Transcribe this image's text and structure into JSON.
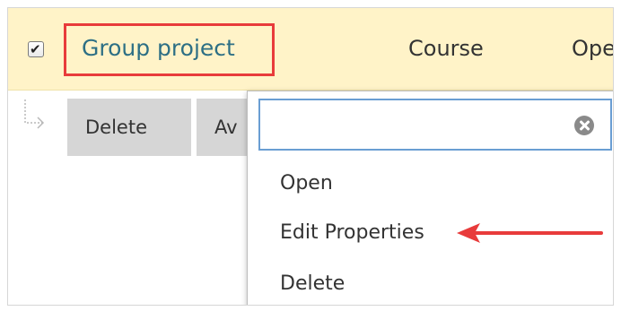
{
  "item_row": {
    "checkbox_checked": true,
    "title": "Group project",
    "course_label": "Course",
    "open_label_partial": "Ope"
  },
  "actions": {
    "delete_label": "Delete",
    "second_label_partial": "Av"
  },
  "context_menu": {
    "filter_value": "",
    "filter_placeholder": "",
    "items": [
      {
        "label": "Open"
      },
      {
        "label": "Edit Properties"
      },
      {
        "label": "Delete"
      }
    ]
  },
  "colors": {
    "header_background": "#fff3c8",
    "title_link": "#2d6f85",
    "highlight_box": "#e83b3b",
    "annotation_arrow": "#e83b3b",
    "button_background": "#d6d6d6",
    "input_focus_border": "#6a9ed3"
  },
  "icons": {
    "checkbox": "checkbox-checked-icon",
    "connector": "subrow-arrow-icon",
    "clear": "clear-circle-x-icon",
    "annotation": "left-arrow-annotation-icon"
  }
}
